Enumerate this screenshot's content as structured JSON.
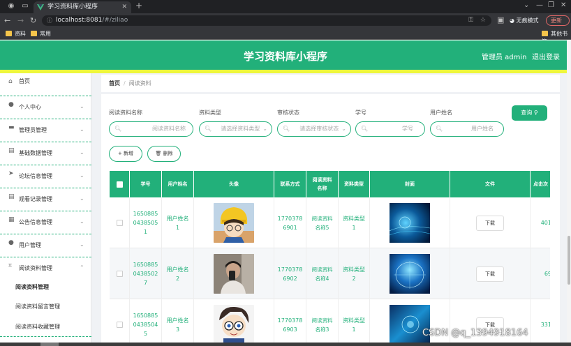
{
  "browser": {
    "tab_title": "学习资料库小程序",
    "url_host": "localhost:8081",
    "url_path": "/#/ziliao",
    "incognito_label": "无痕模式",
    "update_label": "更新",
    "bookmarks": [
      "资料",
      "常用"
    ],
    "other_bookmarks": "其他书签"
  },
  "header": {
    "title": "学习资料库小程序",
    "user": "管理员 admin",
    "logout": "退出登录",
    "accent": "#22b07a"
  },
  "sidebar": {
    "items": [
      {
        "label": "首页",
        "icon": "home-icon"
      },
      {
        "label": "个人中心",
        "icon": "user-icon"
      },
      {
        "label": "管理员管理",
        "icon": "monitor-icon"
      },
      {
        "label": "基础数据管理",
        "icon": "clipboard-icon"
      },
      {
        "label": "论坛信息管理",
        "icon": "send-icon"
      },
      {
        "label": "观看记录管理",
        "icon": "clipboard-icon"
      },
      {
        "label": "公告信息管理",
        "icon": "grid-icon"
      },
      {
        "label": "用户管理",
        "icon": "user-icon"
      },
      {
        "label": "阅读资料管理",
        "icon": "crop-icon"
      }
    ],
    "subitems": [
      "阅读资料管理",
      "阅读资料留言管理",
      "阅读资料收藏管理"
    ]
  },
  "breadcrumb": {
    "home": "首页",
    "sep": "/",
    "current": "阅读资料"
  },
  "filters": {
    "name_label": "阅读资料名称",
    "name_placeholder": "阅读资料名称",
    "type_label": "资料类型",
    "type_placeholder": "请选择资料类型",
    "status_label": "审核状态",
    "status_placeholder": "请选择审核状态",
    "sno_label": "学号",
    "sno_placeholder": "学号",
    "uname_label": "用户姓名",
    "uname_placeholder": "用户姓名",
    "query_button": "查询"
  },
  "actions": {
    "add": "新增",
    "delete": "删除"
  },
  "table": {
    "headers": [
      "学号",
      "用户姓名",
      "头像",
      "联系方式",
      "阅读资料名称",
      "资料类型",
      "封面",
      "文件",
      "点击次"
    ],
    "download_label": "下载",
    "rows": [
      {
        "sno": "16508850438505 1",
        "uname": "用户姓名1",
        "phone": "17703786901",
        "name": "阅读资料名称5",
        "type": "资料类型1",
        "clicks": "401"
      },
      {
        "sno": "16508850438502 7",
        "uname": "用户姓名2",
        "phone": "17703786902",
        "name": "阅读资料名称4",
        "type": "资料类型2",
        "clicks": "69"
      },
      {
        "sno": "16508850438504 5",
        "uname": "用户姓名3",
        "phone": "17703786903",
        "name": "阅读资料名称3",
        "type": "资料类型1",
        "clicks": "331"
      }
    ]
  },
  "watermark": "CSDN @q_1394918164"
}
